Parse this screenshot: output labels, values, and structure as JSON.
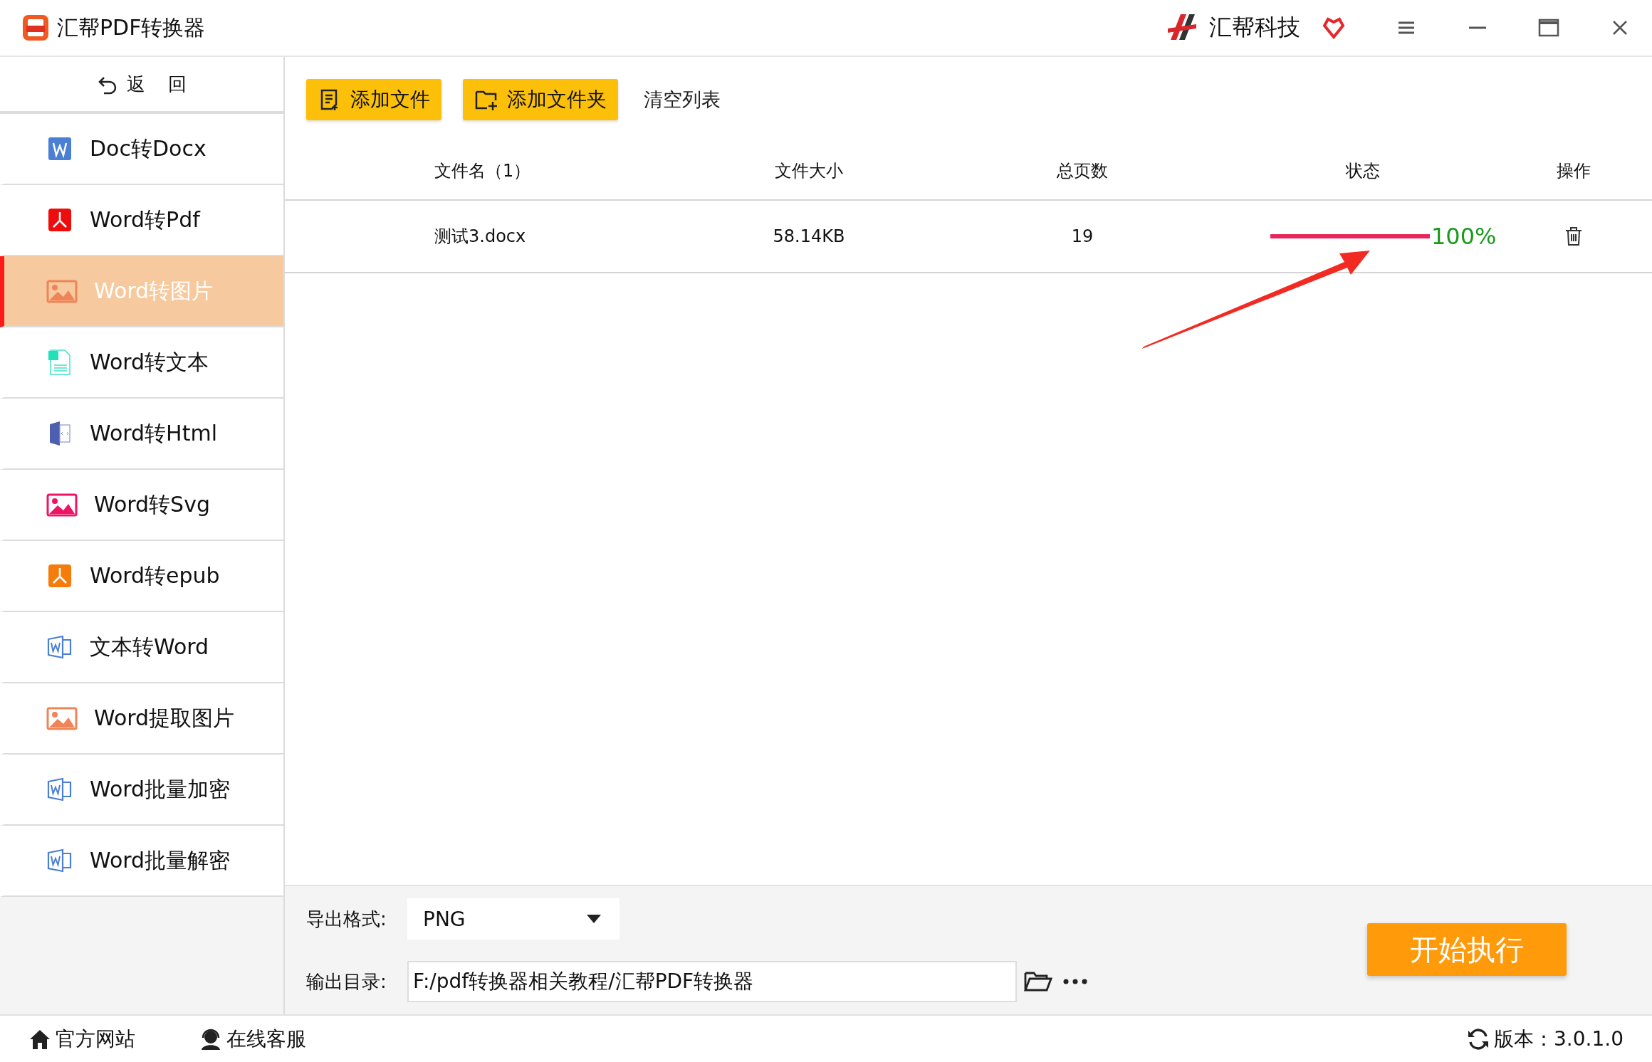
{
  "window": {
    "title": "汇帮PDF转换器",
    "brand": "汇帮科技"
  },
  "sidebar": {
    "back": "返 回",
    "items": [
      {
        "label": "Doc转Docx",
        "kind": "word-fill",
        "selected": false
      },
      {
        "label": "Word转Pdf",
        "kind": "pdf-red",
        "selected": false
      },
      {
        "label": "Word转图片",
        "kind": "picture-orange",
        "selected": true
      },
      {
        "label": "Word转文本",
        "kind": "text-doc",
        "selected": false
      },
      {
        "label": "Word转Html",
        "kind": "html-doc",
        "selected": false
      },
      {
        "label": "Word转Svg",
        "kind": "picture-pink",
        "selected": false
      },
      {
        "label": "Word转epub",
        "kind": "pdf-orange",
        "selected": false
      },
      {
        "label": "文本转Word",
        "kind": "word-outline",
        "selected": false
      },
      {
        "label": "Word提取图片",
        "kind": "picture-orange",
        "selected": false
      },
      {
        "label": "Word批量加密",
        "kind": "word-outline",
        "selected": false
      },
      {
        "label": "Word批量解密",
        "kind": "word-outline",
        "selected": false
      }
    ]
  },
  "toolbar": [
    {
      "label": "添加文件",
      "kind": "add-file"
    },
    {
      "label": "添加文件夹",
      "kind": "add-folder"
    },
    {
      "label": "清空列表",
      "kind": "plain"
    }
  ],
  "table": {
    "columns": [
      "文件名（1）",
      "文件大小",
      "总页数",
      "状态",
      "操作"
    ],
    "rows": [
      {
        "name": "测试3.docx",
        "size": "58.14KB",
        "pages": "19",
        "level": 1,
        "reading": "100%"
      }
    ]
  },
  "output": {
    "format_label": "导出格式:",
    "format": "PNG",
    "dir_label": "输出目录:",
    "dir": "F:/pdf转换器相关教程/汇帮PDF转换器",
    "start": "开始执行"
  },
  "footer": {
    "website": "官方网站",
    "service": "在线客服",
    "version": "版本：3.0.1.0"
  }
}
